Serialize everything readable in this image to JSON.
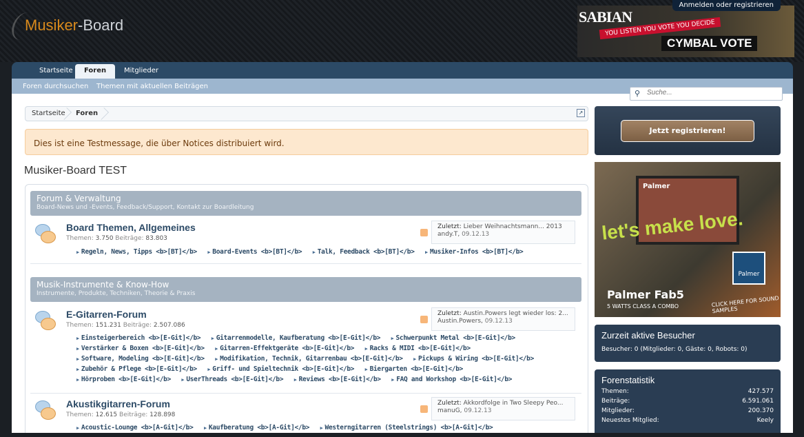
{
  "header": {
    "logo_text_1": "Musiker",
    "logo_text_2": "-Board",
    "login_link": "Anmelden oder registrieren",
    "banner": {
      "brand": "SABIAN",
      "slogan": "YOU LISTEN YOU VOTE YOU DECIDE",
      "vote": "CYMBAL VOTE"
    }
  },
  "nav": {
    "tabs": [
      {
        "label": "Startseite"
      },
      {
        "label": "Foren"
      },
      {
        "label": "Mitglieder"
      }
    ],
    "sub_links": [
      {
        "label": "Foren durchsuchen"
      },
      {
        "label": "Themen mit aktuellen Beiträgen"
      }
    ]
  },
  "search": {
    "placeholder": "Suche..."
  },
  "breadcrumb": {
    "items": [
      "Startseite",
      "Foren"
    ]
  },
  "notice": {
    "text": "Dies ist eine Testmessage, die über Notices distribuiert wird."
  },
  "page_title": "Musiker-Board TEST",
  "categories": [
    {
      "title": "Forum & Verwaltung",
      "description": "Board-News und -Events, Feedback/Support, Kontakt zur Boardleitung",
      "forums": [
        {
          "title": "Board Themen, Allgemeines",
          "threads_label": "Themen:",
          "threads": "3.750",
          "posts_label": "Beiträge:",
          "posts": "83.803",
          "last_label": "Zuletzt:",
          "last_title": "Lieber Weihnachtsmann... 2013",
          "last_user": "andy.T,",
          "last_date": "09.12.13",
          "subforums": [
            [
              "Regeln, News, Tipps <b>[BT]</b>",
              "Board-Events <b>[BT]</b>",
              "Talk, Feedback <b>[BT]</b>",
              "Musiker-Infos <b>[BT]</b>"
            ]
          ]
        }
      ]
    },
    {
      "title": "Musik-Instrumente & Know-How",
      "description": "Instrumente, Produkte, Techniken, Theorie & Praxis",
      "forums": [
        {
          "title": "E-Gitarren-Forum",
          "threads_label": "Themen:",
          "threads": "151.231",
          "posts_label": "Beiträge:",
          "posts": "2.507.086",
          "last_label": "Zuletzt:",
          "last_title": "Austin.Powers legt wieder los: 2...",
          "last_user": "Austin.Powers,",
          "last_date": "09.12.13",
          "subforums": [
            [
              "Einsteigerbereich <b>[E-Git]</b>",
              "Gitarrenmodelle, Kaufberatung <b>[E-Git]</b>",
              "Schwerpunkt Metal <b>[E-Git]</b>"
            ],
            [
              "Verstärker & Boxen <b>[E-Git]</b>",
              "Gitarren-Effektgeräte <b>[E-Git]</b>",
              "Racks & MIDI <b>[E-Git]</b>"
            ],
            [
              "Software, Modeling <b>[E-Git]</b>",
              "Modifikation, Technik, Gitarrenbau <b>[E-Git]</b>",
              "Pickups & Wiring <b>[E-Git]</b>"
            ],
            [
              "Zubehör & Pflege <b>[E-Git]</b>",
              "Griff- und Spieltechnik <b>[E-Git]</b>",
              "Biergarten <b>[E-Git]</b>"
            ],
            [
              "Hörproben <b>[E-Git]</b>",
              "UserThreads <b>[E-Git]</b>",
              "Reviews <b>[E-Git]</b>",
              "FAQ and Workshop <b>[E-Git]</b>"
            ]
          ]
        },
        {
          "title": "Akustikgitarren-Forum",
          "threads_label": "Themen:",
          "threads": "12.615",
          "posts_label": "Beiträge:",
          "posts": "128.898",
          "last_label": "Zuletzt:",
          "last_title": "Akkordfolge in Two Sleepy Peo...",
          "last_user": "manuG,",
          "last_date": "09.12.13",
          "subforums": [
            [
              "Acoustic-Lounge <b>[A-Git]</b>",
              "Kaufberatung <b>[A-Git]</b>",
              "Westerngitarren (Steelstrings) <b>[A-Git]</b>"
            ]
          ]
        }
      ]
    }
  ],
  "sidebar": {
    "register_button": "Jetzt registrieren!",
    "ad": {
      "amp_brand": "Palmer",
      "slogan": "let's make love.",
      "product": "Palmer Fab5",
      "sub": "5 WATTS CLASS A COMBO",
      "cta": "CLICK HERE FOR SOUND SAMPLES",
      "logo": "Palmer"
    },
    "visitors": {
      "title": "Zurzeit aktive Besucher",
      "text": "Besucher: 0 (Mitglieder: 0, Gäste: 0, Robots: 0)"
    },
    "stats": {
      "title": "Forenstatistik",
      "rows": [
        {
          "label": "Themen:",
          "value": "427.577"
        },
        {
          "label": "Beiträge:",
          "value": "6.591.061"
        },
        {
          "label": "Mitglieder:",
          "value": "200.370"
        },
        {
          "label": "Neuestes Mitglied:",
          "value": "Keely"
        }
      ]
    }
  }
}
